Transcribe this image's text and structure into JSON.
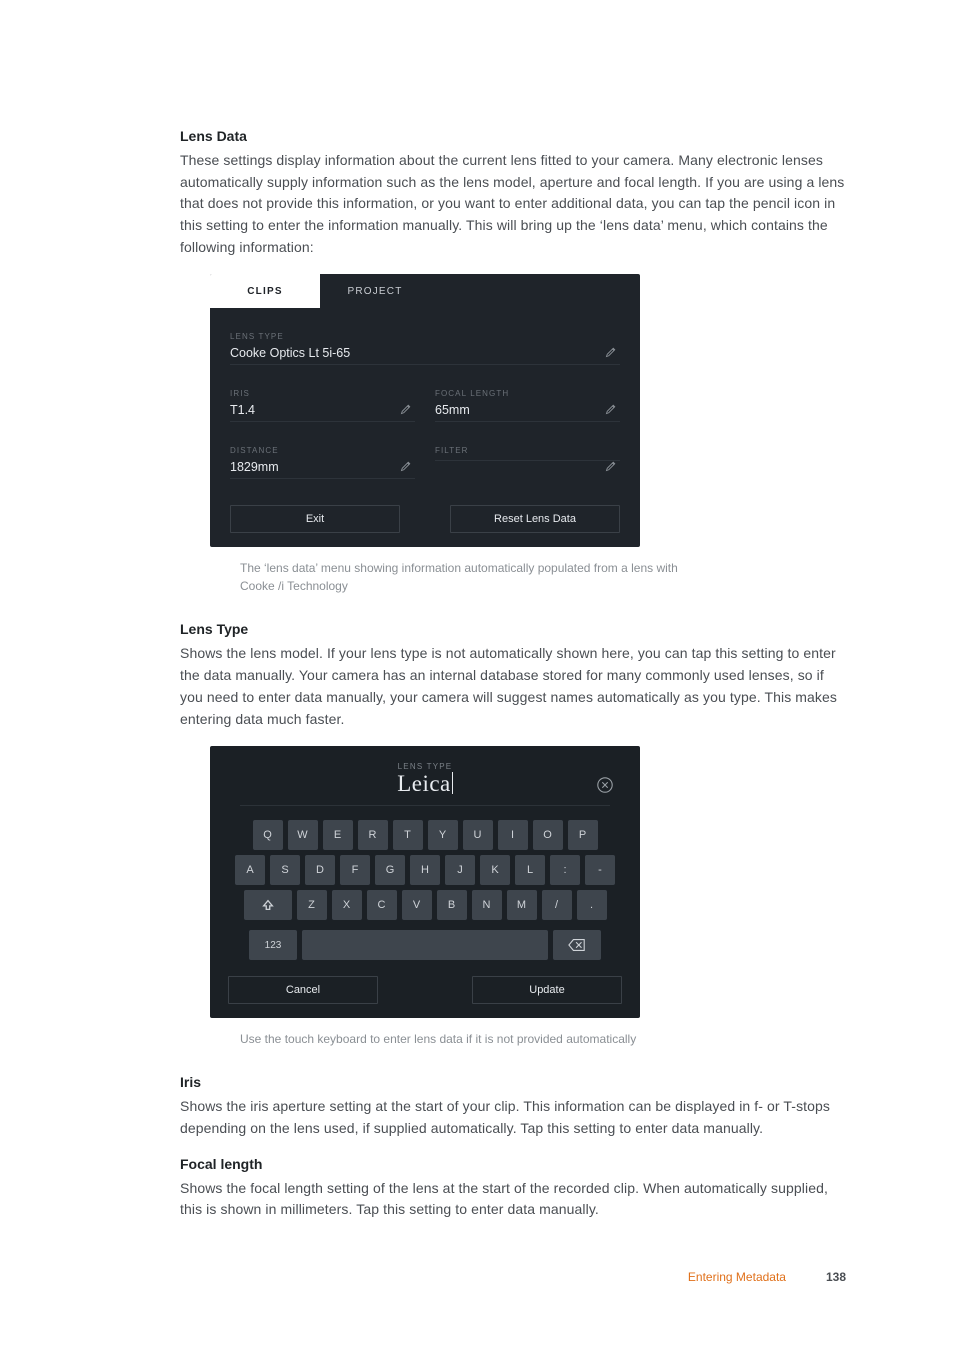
{
  "sections": {
    "lensDataHeading": "Lens Data",
    "lensDataBody": "These settings display information about the current lens fitted to your camera. Many electronic lenses automatically supply information such as the lens model, aperture and focal length. If you are using a lens that does not provide this information, or you want to enter additional data, you can tap the pencil icon in this setting to enter the information manually. This will bring up the ‘lens data’ menu, which contains the following information:",
    "lensDataCaption": "The ‘lens data’ menu showing information automatically populated from a lens with Cooke /i Technology",
    "lensTypeHeading": "Lens Type",
    "lensTypeBody": "Shows the lens model. If your lens type is not automatically shown here, you can tap this setting to enter the data manually. Your camera has an internal database stored for many commonly used lenses, so if you need to enter data manually, your camera will suggest names automatically as you type. This makes entering data much faster.",
    "keyboardCaption": "Use the touch keyboard to enter lens data if it is not provided automatically",
    "irisHeading": "Iris",
    "irisBody": "Shows the iris aperture setting at the start of your clip. This information can be displayed in f- or T-stops depending on the lens used, if supplied automatically. Tap this setting to enter data manually.",
    "focalHeading": "Focal length",
    "focalBody": "Shows the focal length setting of the lens at the start of the recorded clip. When automatically supplied, this is shown in millimeters. Tap this setting to enter data manually."
  },
  "lensPanel": {
    "tabs": {
      "clips": "CLIPS",
      "project": "PROJECT"
    },
    "fields": {
      "lensType": {
        "label": "LENS TYPE",
        "value": "Cooke Optics Lt 5i-65"
      },
      "iris": {
        "label": "IRIS",
        "value": "T1.4"
      },
      "focal": {
        "label": "FOCAL LENGTH",
        "value": "65mm"
      },
      "distance": {
        "label": "DISTANCE",
        "value": "1829mm"
      },
      "filter": {
        "label": "FILTER",
        "value": ""
      }
    },
    "buttons": {
      "exit": "Exit",
      "reset": "Reset Lens Data"
    }
  },
  "keyboard": {
    "label": "LENS TYPE",
    "input": "Leica",
    "rows": [
      [
        "Q",
        "W",
        "E",
        "R",
        "T",
        "Y",
        "U",
        "I",
        "O",
        "P"
      ],
      [
        "A",
        "S",
        "D",
        "F",
        "G",
        "H",
        "J",
        "K",
        "L",
        ":",
        "-"
      ],
      [
        "Z",
        "X",
        "C",
        "V",
        "B",
        "N",
        "M",
        "/",
        "."
      ]
    ],
    "k123": "123",
    "buttons": {
      "cancel": "Cancel",
      "update": "Update"
    }
  },
  "footer": {
    "section": "Entering Metadata",
    "page": "138"
  }
}
